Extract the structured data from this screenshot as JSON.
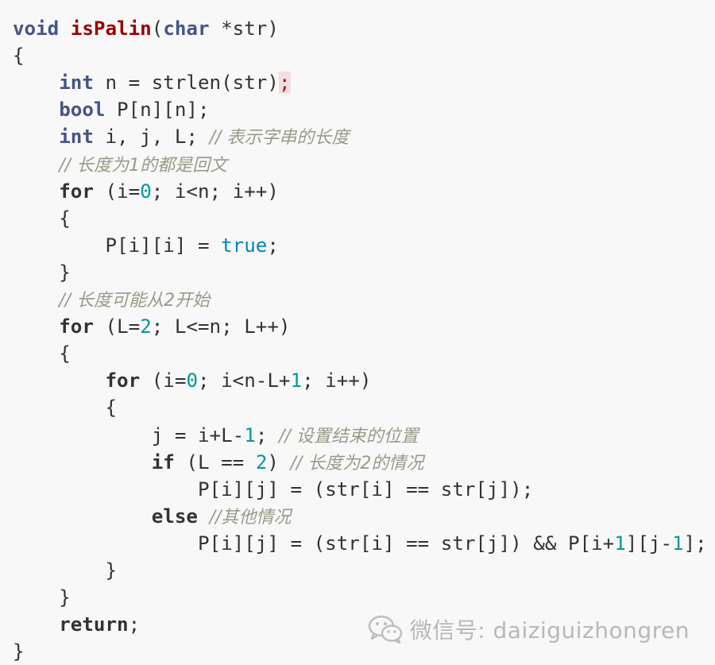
{
  "code": {
    "lines": [
      {
        "tokens": [
          {
            "t": "void",
            "c": "kt"
          },
          {
            "t": " "
          },
          {
            "t": "isPalin",
            "c": "fn"
          },
          {
            "t": "("
          },
          {
            "t": "char",
            "c": "kt"
          },
          {
            "t": " *str)"
          }
        ]
      },
      {
        "tokens": [
          {
            "t": "{"
          }
        ]
      },
      {
        "tokens": [
          {
            "t": "    "
          },
          {
            "t": "int",
            "c": "kt"
          },
          {
            "t": " n = strlen(str)"
          },
          {
            "t": ";",
            "c": "err"
          }
        ]
      },
      {
        "tokens": [
          {
            "t": "    "
          },
          {
            "t": "bool",
            "c": "kt"
          },
          {
            "t": " P[n][n];"
          }
        ]
      },
      {
        "tokens": [
          {
            "t": "    "
          },
          {
            "t": "int",
            "c": "kt"
          },
          {
            "t": " i, j, L; "
          },
          {
            "t": "// 表示字串的长度",
            "c": "cm"
          }
        ]
      },
      {
        "tokens": [
          {
            "t": "    "
          },
          {
            "t": "// 长度为1的都是回文",
            "c": "cm"
          }
        ]
      },
      {
        "tokens": [
          {
            "t": "    "
          },
          {
            "t": "for",
            "c": "kw"
          },
          {
            "t": " (i="
          },
          {
            "t": "0",
            "c": "num"
          },
          {
            "t": "; i<n; i++)"
          }
        ]
      },
      {
        "tokens": [
          {
            "t": "    {"
          }
        ]
      },
      {
        "tokens": [
          {
            "t": "        P[i][i] = "
          },
          {
            "t": "true",
            "c": "bool"
          },
          {
            "t": ";"
          }
        ]
      },
      {
        "tokens": [
          {
            "t": "    }"
          }
        ]
      },
      {
        "tokens": [
          {
            "t": "    "
          },
          {
            "t": "// 长度可能从2开始",
            "c": "cm"
          }
        ]
      },
      {
        "tokens": [
          {
            "t": "    "
          },
          {
            "t": "for",
            "c": "kw"
          },
          {
            "t": " (L="
          },
          {
            "t": "2",
            "c": "num"
          },
          {
            "t": "; L<=n; L++)"
          }
        ]
      },
      {
        "tokens": [
          {
            "t": "    {"
          }
        ]
      },
      {
        "tokens": [
          {
            "t": "        "
          },
          {
            "t": "for",
            "c": "kw"
          },
          {
            "t": " (i="
          },
          {
            "t": "0",
            "c": "num"
          },
          {
            "t": "; i<n-L+"
          },
          {
            "t": "1",
            "c": "num"
          },
          {
            "t": "; i++)"
          }
        ]
      },
      {
        "tokens": [
          {
            "t": "        {"
          }
        ]
      },
      {
        "tokens": [
          {
            "t": "            j = i+L-"
          },
          {
            "t": "1",
            "c": "num"
          },
          {
            "t": "; "
          },
          {
            "t": "// 设置结束的位置",
            "c": "cm"
          }
        ]
      },
      {
        "tokens": [
          {
            "t": "            "
          },
          {
            "t": "if",
            "c": "kw"
          },
          {
            "t": " (L == "
          },
          {
            "t": "2",
            "c": "num"
          },
          {
            "t": ") "
          },
          {
            "t": "// 长度为2的情况",
            "c": "cm"
          }
        ]
      },
      {
        "tokens": [
          {
            "t": "                P[i][j] = (str[i] == str[j]);"
          }
        ]
      },
      {
        "tokens": [
          {
            "t": "            "
          },
          {
            "t": "else",
            "c": "kw"
          },
          {
            "t": " "
          },
          {
            "t": "//其他情况",
            "c": "cm"
          }
        ]
      },
      {
        "tokens": [
          {
            "t": "                P[i][j] = (str[i] == str[j]) && P[i+"
          },
          {
            "t": "1",
            "c": "num"
          },
          {
            "t": "][j-"
          },
          {
            "t": "1",
            "c": "num"
          },
          {
            "t": "];"
          }
        ]
      },
      {
        "tokens": [
          {
            "t": "        }"
          }
        ]
      },
      {
        "tokens": [
          {
            "t": "    }"
          }
        ]
      },
      {
        "tokens": [
          {
            "t": "    "
          },
          {
            "t": "return",
            "c": "kw"
          },
          {
            "t": ";"
          }
        ]
      },
      {
        "tokens": [
          {
            "t": "}"
          }
        ]
      }
    ]
  },
  "watermark": {
    "icon": "wechat-icon",
    "label": "微信号: daiziguizhongren"
  },
  "colors": {
    "background": "#f8f8f8",
    "text": "#333333",
    "type_keyword": "#445588",
    "function_name": "#990000",
    "number": "#009999",
    "boolean": "#0086b3",
    "comment": "#999988",
    "error_highlight": "#f2dede"
  }
}
